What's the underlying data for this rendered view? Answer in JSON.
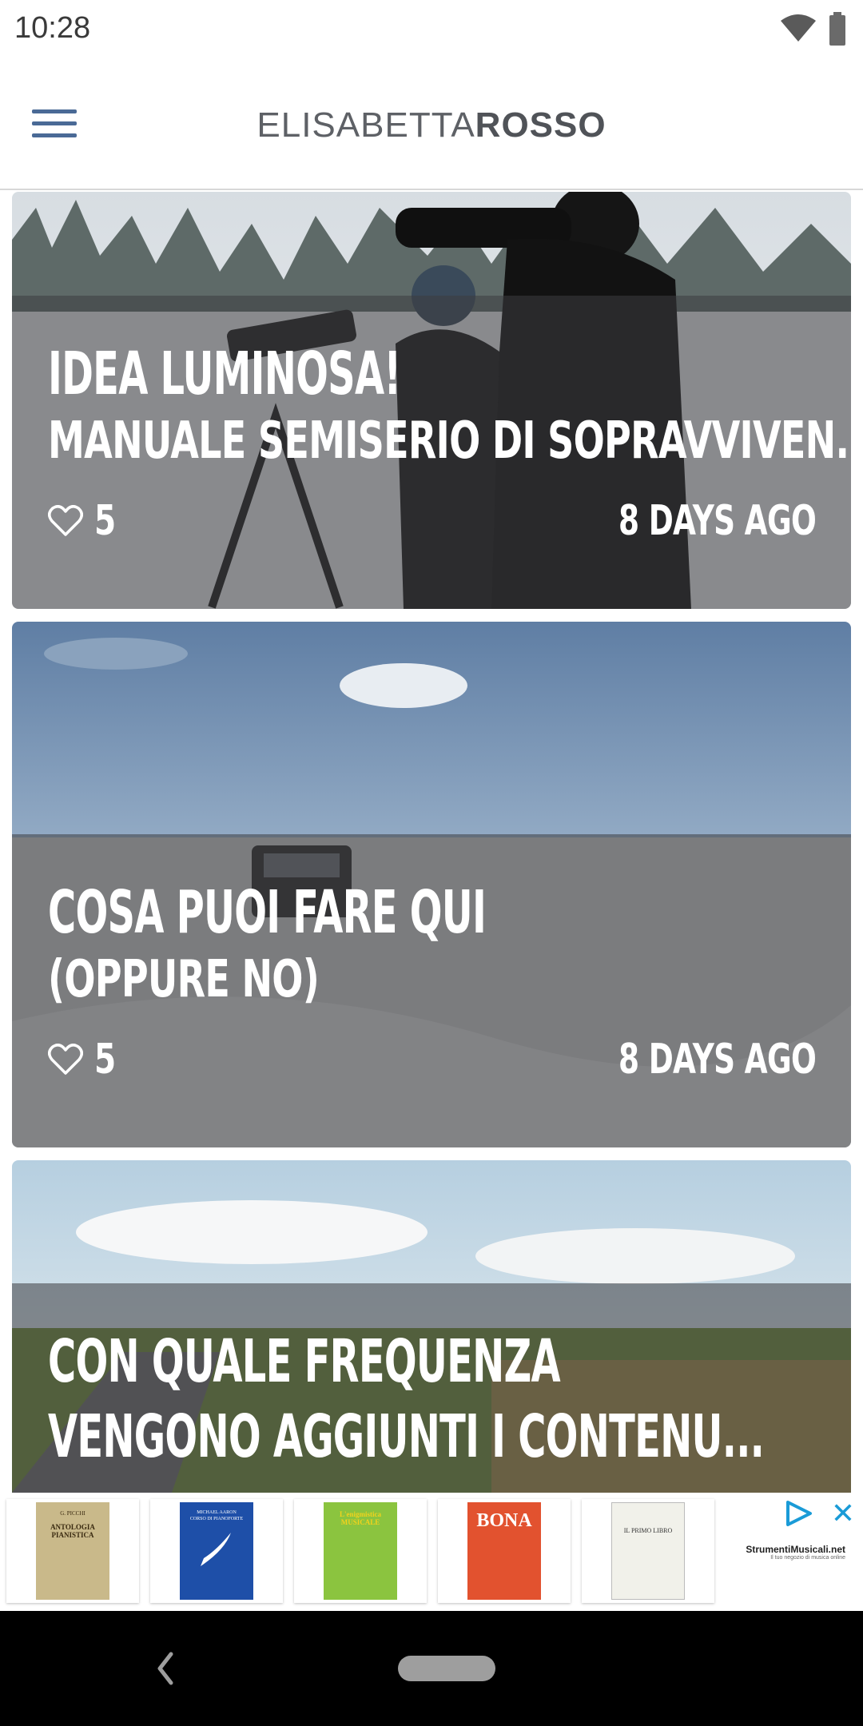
{
  "status_bar": {
    "time": "10:28"
  },
  "app_bar": {
    "brand_light": "ELISABETTA",
    "brand_bold": "ROSSO"
  },
  "articles": [
    {
      "title": "IDEA LUMINOSA!",
      "subtitle": "MANUALE SEMISERIO DI SOPRAVVIVEN...",
      "likes": "5",
      "date": "8 DAYS AGO"
    },
    {
      "title": "COSA PUOI FARE QUI",
      "subtitle": "(OPPURE NO)",
      "likes": "5",
      "date": "8 DAYS AGO"
    },
    {
      "title": "CON QUALE FREQUENZA",
      "subtitle": "VENGONO AGGIUNTI I CONTENU..."
    }
  ],
  "ad": {
    "books": [
      {
        "title_top": "G. PICCHI",
        "title": "ANTOLOGIA PIANISTICA",
        "color": "#c9b98a"
      },
      {
        "title_top": "MICHAEL AARON",
        "title": "CORSO DI PIANOFORTE",
        "color": "#1e4fa8"
      },
      {
        "title_top": "",
        "title": "L'enigmistica MUSICALE",
        "color": "#8bc43f"
      },
      {
        "title_top": "",
        "title": "BONA",
        "color": "#e2522f"
      },
      {
        "title_top": "",
        "title": "IL PRIMO LIBRO",
        "color": "#f1f1ea"
      }
    ],
    "brand": "StrumentiMusicali.net",
    "brand_tagline": "Il tuo negozio di musica online"
  },
  "colors": {
    "menu_icon": "#4a6a96",
    "ad_accent": "#1a9bd7"
  },
  "icons": {
    "menu": "hamburger-menu-icon",
    "like": "heart-outline-icon",
    "wifi": "wifi-icon",
    "battery": "battery-icon",
    "back": "back-chevron-icon"
  }
}
